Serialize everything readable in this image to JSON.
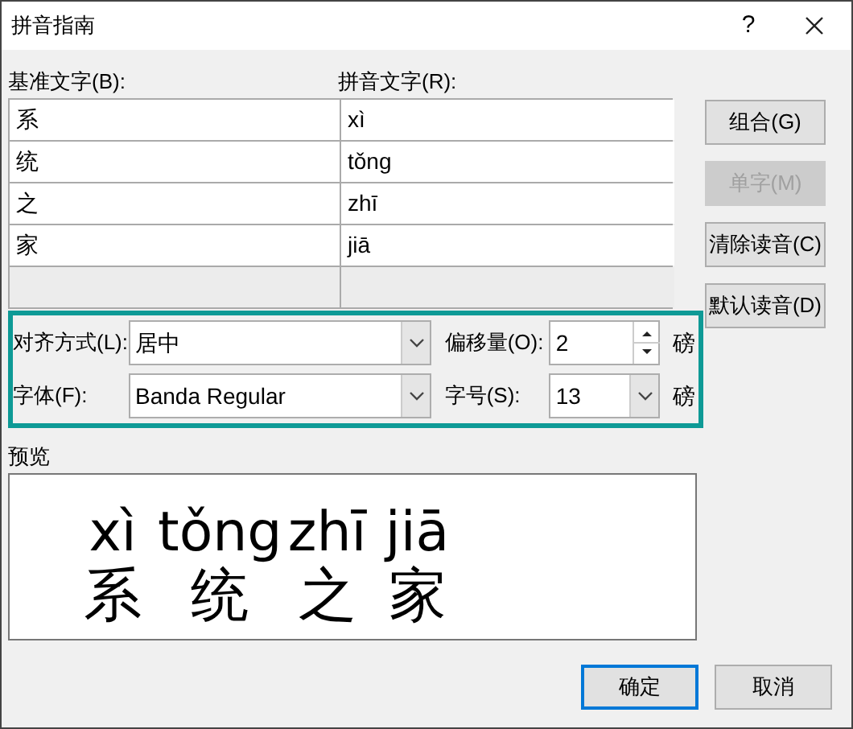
{
  "window": {
    "title": "拼音指南",
    "help": "?"
  },
  "columns": [
    "基准文字(B):",
    "拼音文字(R):"
  ],
  "rows": [
    {
      "base": "系",
      "ruby": "xì"
    },
    {
      "base": "统",
      "ruby": "tǒng"
    },
    {
      "base": "之",
      "ruby": "zhī"
    },
    {
      "base": "家",
      "ruby": "jiā"
    },
    {
      "base": "",
      "ruby": "",
      "disabled": true
    }
  ],
  "side_buttons": [
    {
      "label": "组合(G)",
      "disabled": false
    },
    {
      "label": "单字(M)",
      "disabled": true
    },
    {
      "label": "清除读音(C)",
      "disabled": false
    },
    {
      "label": "默认读音(D)",
      "disabled": false
    }
  ],
  "options": [
    {
      "label": "对齐方式(L):",
      "value": "居中",
      "side_label": "偏移量(O):",
      "side_field": {
        "kind": "spin",
        "value": "2"
      },
      "unit": "磅"
    },
    {
      "label": "字体(F):",
      "value": "Banda Regular",
      "side_label": "字号(S):",
      "side_field": {
        "kind": "combo",
        "value": "13"
      },
      "unit": "磅"
    }
  ],
  "preview": {
    "label": "预览",
    "items": [
      {
        "ruby": "xì",
        "base": "系"
      },
      {
        "ruby": "tǒng",
        "base": "统"
      },
      {
        "ruby": "zhī",
        "base": "之"
      },
      {
        "ruby": "jiā",
        "base": "家"
      }
    ]
  },
  "buttons": [
    {
      "label": "确定",
      "default": true
    },
    {
      "label": "取消",
      "default": false
    }
  ]
}
